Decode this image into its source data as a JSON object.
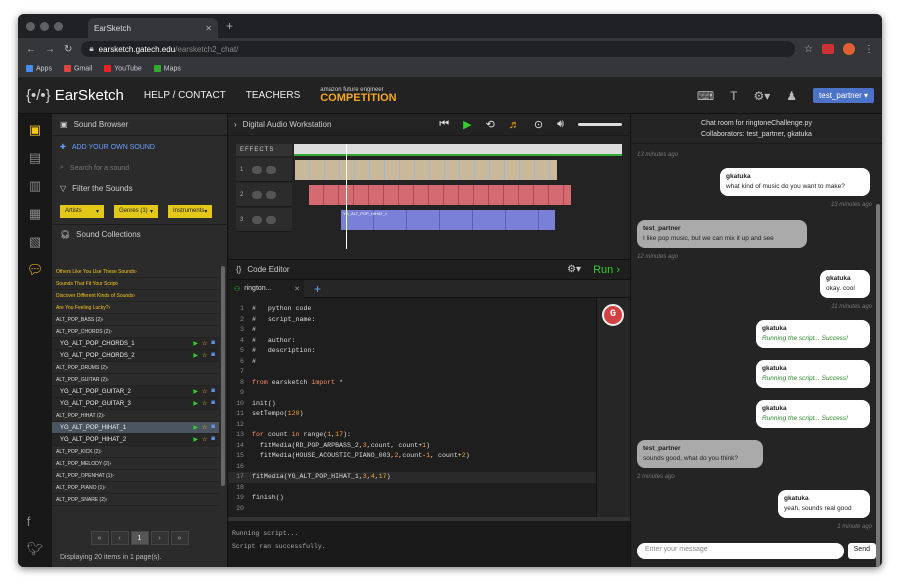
{
  "browser": {
    "tab_title": "EarSketch",
    "url_host": "earsketch.gatech.edu",
    "url_path": "/earsketch2_chat/",
    "bookmarks": [
      "Apps",
      "Gmail",
      "YouTube",
      "Maps"
    ]
  },
  "header": {
    "brand": "EarSketch",
    "brand_mark": "{•/•}",
    "nav": [
      "HELP / CONTACT",
      "TEACHERS"
    ],
    "competition_sponsor": "amazon future engineer",
    "competition": "COMPETITION",
    "user": "test_partner"
  },
  "sidebar": {
    "title": "Sound Browser",
    "add_sound": "ADD YOUR OWN SOUND",
    "search_placeholder": "Search for a sound",
    "filter_title": "Filter the Sounds",
    "filters": [
      "Artists",
      "Genres (1)",
      "Instruments"
    ],
    "collections_title": "Sound Collections",
    "collections": [
      {
        "label": "Others Like You Use These Sounds",
        "type": "y"
      },
      {
        "label": "Sounds That Fit Your Script",
        "type": "y"
      },
      {
        "label": "Discover Different Kinds of Sounds",
        "type": "y"
      },
      {
        "label": "Are You Feeling Lucky?",
        "type": "y"
      },
      {
        "label": "ALT_POP_BASS (2)",
        "type": "g"
      },
      {
        "label": "ALT_POP_CHORDS (2)",
        "type": "g"
      },
      {
        "label": "YG_ALT_POP_CHORDS_1",
        "type": "sub"
      },
      {
        "label": "YG_ALT_POP_CHORDS_2",
        "type": "sub"
      },
      {
        "label": "ALT_POP_DRUMS (2)",
        "type": "g"
      },
      {
        "label": "ALT_POP_GUITAR (2)",
        "type": "g"
      },
      {
        "label": "YG_ALT_POP_GUITAR_2",
        "type": "sub"
      },
      {
        "label": "YG_ALT_POP_GUITAR_3",
        "type": "sub"
      },
      {
        "label": "ALT_POP_HIHAT (2)",
        "type": "g"
      },
      {
        "label": "YG_ALT_POP_HIHAT_1",
        "type": "sel"
      },
      {
        "label": "YG_ALT_POP_HIHAT_2",
        "type": "sub"
      },
      {
        "label": "ALT_POP_KICK (2)",
        "type": "g"
      },
      {
        "label": "ALT_POP_MELODY (2)",
        "type": "g"
      },
      {
        "label": "ALT_POP_OPENHAT (1)",
        "type": "g"
      },
      {
        "label": "ALT_POP_PIANO (1)",
        "type": "g"
      },
      {
        "label": "ALT_POP_SNARE (2)",
        "type": "g"
      }
    ],
    "pager": [
      "«",
      "‹",
      "1",
      "›",
      "»"
    ],
    "pager_text": "Displaying 20 items in 1 page(s)."
  },
  "daw": {
    "title": "Digital Audio Workstation",
    "effects_label": "EFFECTS",
    "tracks": [
      "1",
      "2",
      "3"
    ],
    "clip_label": "YG_ALT_POP_HIHAT_1"
  },
  "editor": {
    "title": "Code Editor",
    "run_label": "Run",
    "tab_name": "rington...",
    "grammarly": "G",
    "console": [
      "Running script...",
      "Script ran successfully."
    ]
  },
  "chat": {
    "title": "Chat room for ringtoneChallenge.py",
    "collaborators": "Collaborators: test_partner, gkatuka",
    "input_placeholder": "Enter your message",
    "send_label": "Send",
    "messages": [
      {
        "ts": "13 minutes ago"
      },
      {
        "user": "gkatuka",
        "text": "what kind of music do you want to make?",
        "ts": "13 minutes ago"
      },
      {
        "user": "test_partner",
        "text": "I like pop music, but we can mix it up and see",
        "ts": "12 minutes ago"
      },
      {
        "user": "gkatuka",
        "text": "okay. cool",
        "ts": "11 minutes ago"
      },
      {
        "user": "gkatuka",
        "text": "Running the script... Success!"
      },
      {
        "user": "gkatuka",
        "text": "Running the script... Success!"
      },
      {
        "user": "gkatuka",
        "text": "Running the script... Success!"
      },
      {
        "user": "test_partner",
        "text": "sounds good, what do you think?",
        "ts": "2 minutes ago"
      },
      {
        "user": "gkatuka",
        "text": "yeah, sounds real good",
        "ts": "1 minute ago"
      }
    ]
  }
}
